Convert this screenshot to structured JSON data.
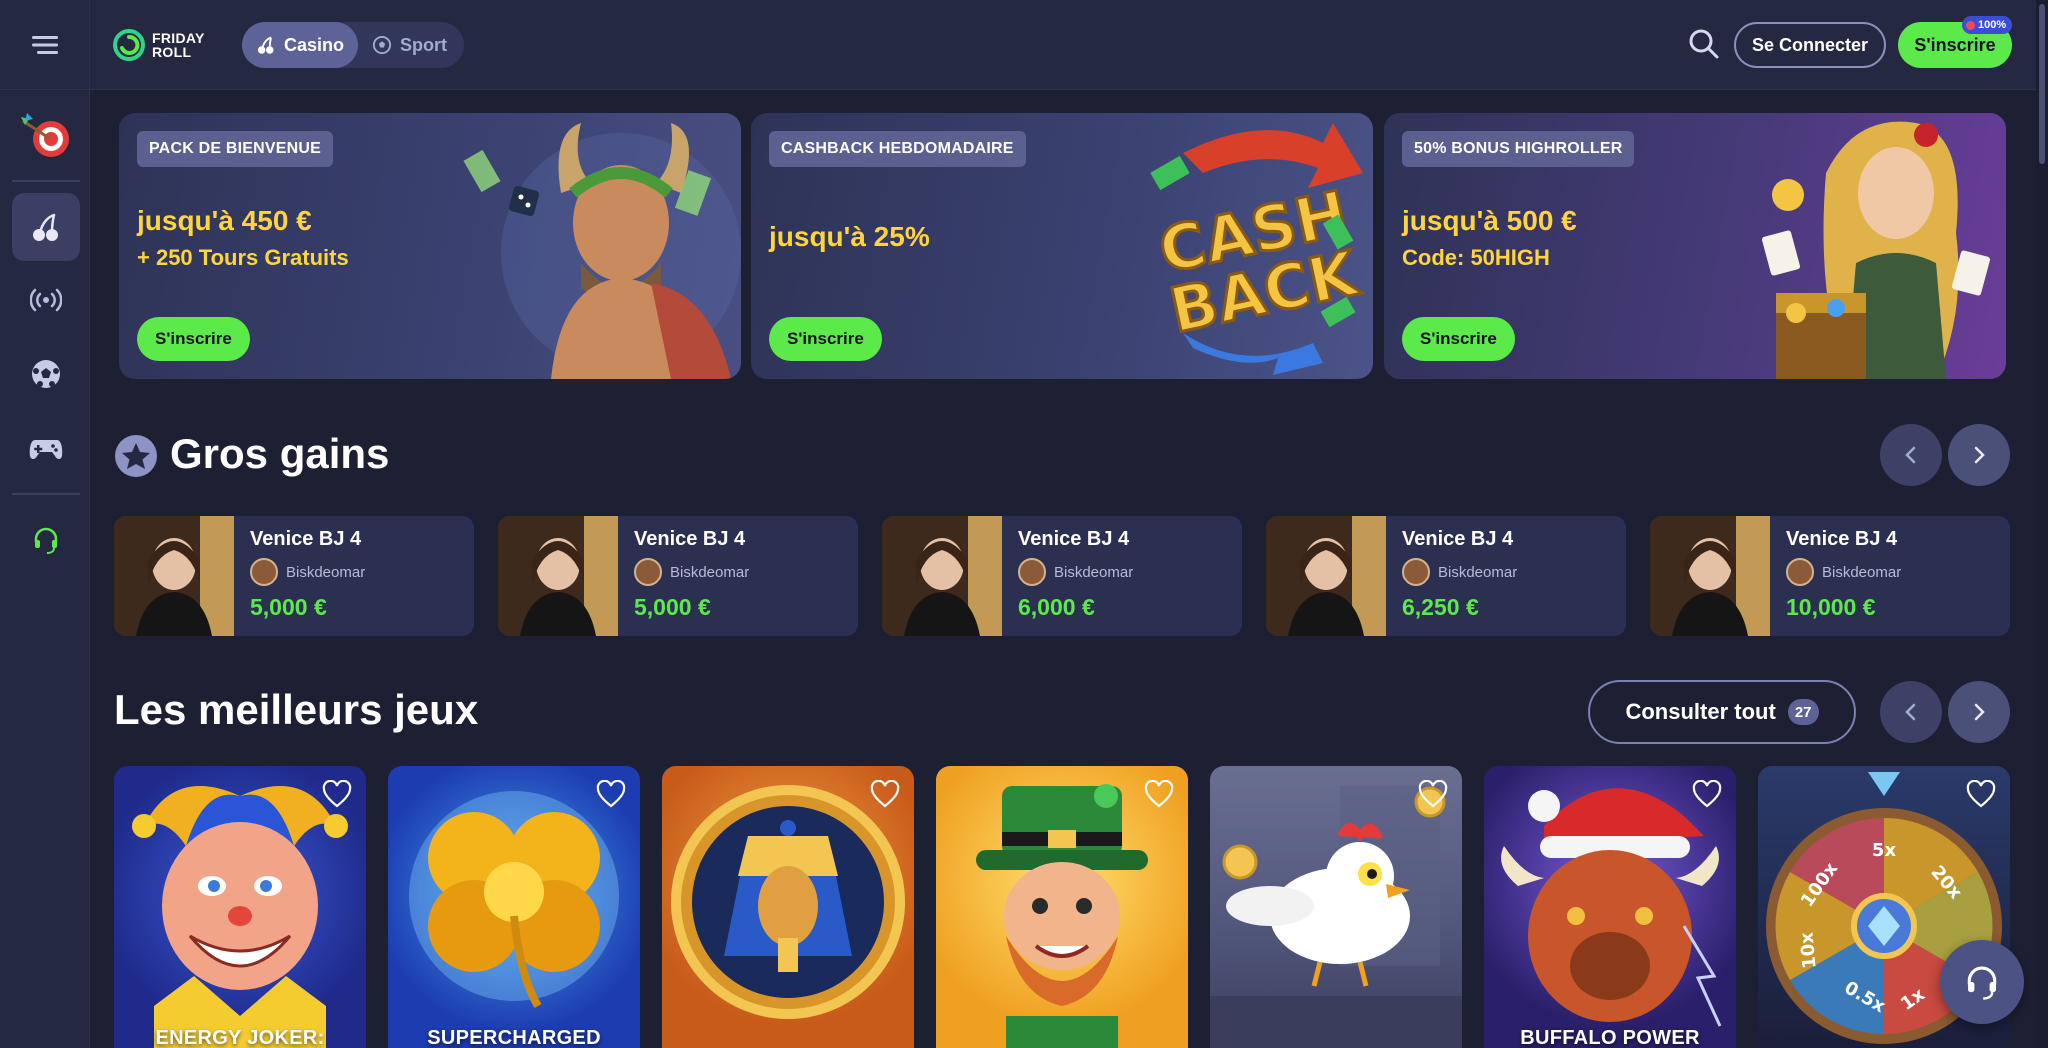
{
  "brand": {
    "name_line1": "FRIDAY",
    "name_line2": "ROLL"
  },
  "header": {
    "modes": [
      {
        "label": "Casino",
        "icon": "cherry-icon",
        "active": true
      },
      {
        "label": "Sport",
        "icon": "soccer-ball-icon",
        "active": false
      }
    ],
    "login_label": "Se Connecter",
    "signup_label": "S'inscrire",
    "signup_badge": "100%"
  },
  "sidebar": {
    "items": [
      {
        "icon": "target-icon",
        "active": false
      },
      {
        "icon": "cherry-icon",
        "active": true
      },
      {
        "icon": "live-broadcast-icon",
        "active": false
      },
      {
        "icon": "soccer-ball-icon",
        "active": false
      },
      {
        "icon": "gamepad-icon",
        "active": false
      },
      {
        "icon": "headset-icon",
        "active": false
      }
    ]
  },
  "promos": [
    {
      "tag": "PACK DE BIENVENUE",
      "amount": "jusqu'à 450 €",
      "sub": "+ 250 Tours Gratuits",
      "cta": "S'inscrire"
    },
    {
      "tag": "CASHBACK HEBDOMADAIRE",
      "amount": "jusqu'à 25%",
      "sub": "",
      "cta": "S'inscrire",
      "art_text_1": "CASH",
      "art_text_2": "BACK"
    },
    {
      "tag": "50% BONUS HIGHROLLER",
      "amount": "jusqu'à 500 €",
      "sub": "Code: 50HIGH",
      "cta": "S'inscrire"
    }
  ],
  "big_wins": {
    "title": "Gros gains",
    "items": [
      {
        "game": "Venice BJ 4",
        "user": "Biskdeomar",
        "amount": "5,000 €"
      },
      {
        "game": "Venice BJ 4",
        "user": "Biskdeomar",
        "amount": "5,000 €"
      },
      {
        "game": "Venice BJ 4",
        "user": "Biskdeomar",
        "amount": "6,000 €"
      },
      {
        "game": "Venice BJ 4",
        "user": "Biskdeomar",
        "amount": "6,250 €"
      },
      {
        "game": "Venice BJ 4",
        "user": "Biskdeomar",
        "amount": "10,000 €"
      }
    ]
  },
  "best_games": {
    "title": "Les meilleurs jeux",
    "view_all_label": "Consulter tout",
    "view_all_count": "27",
    "games": [
      {
        "title": "ENERGY JOKER:",
        "theme": "joker"
      },
      {
        "title": "SUPERCHARGED",
        "theme": "clover"
      },
      {
        "title": "",
        "theme": "pharaoh"
      },
      {
        "title": "",
        "theme": "leprechaun"
      },
      {
        "title": "",
        "theme": "chicken"
      },
      {
        "title": "BUFFALO POWER",
        "theme": "buffalo"
      },
      {
        "title": "",
        "theme": "wheel",
        "wheel_labels": [
          "5x",
          "20x",
          "100x",
          "10x",
          "0.5x",
          "1x"
        ]
      }
    ]
  },
  "colors": {
    "accent_green": "#5cea4b",
    "gold": "#ffd53d",
    "bg": "#1d2033",
    "panel": "#242840"
  }
}
